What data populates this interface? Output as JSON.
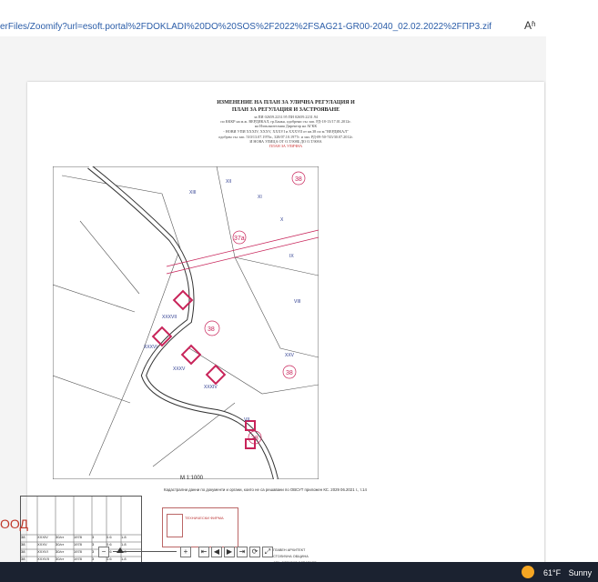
{
  "address_bar": {
    "url": "erFiles/Zoomify?url=esoft.portal%2FDOKLADI%20DO%20SOS%2F2022%2FSAG21-GR00-2040_02.02.2022%2FПР3.zif",
    "reader_label": "Aʱ"
  },
  "document": {
    "title_line1": "ИЗМЕНЕНИЕ НА ПЛАН ЗА УЛИЧНА РЕГУЛАЦИЯ И",
    "title_line2": "ПЛАН ЗА РЕГУЛАЦИЯ И ЗАСТРОЯВАНЕ",
    "subtitle_lines": [
      "за ПИ 02659.2231.95 ПИ 02659.2231.94",
      "по КККР на м.ж. ВЕРДИКАЛ, гр.Банкя, одобрени със зап. РД-18-13/17.01.2012г.",
      "на Изпълнителния Директор на АГКК",
      "- НОВИ УПИ XXXIV, XXXV, XXXVI и XXXVII от кв.38 по м.\"ВЕРДИКАЛ\"",
      "одобрен със зап. 510/13.07.1976г., 328/07.10.1977г. и зап. РД-09-50-745/30.07.2012г.",
      "И НОВА УЛИЦА ОТ О.Т.908Б ДО О.Т.908А",
      "ПЛАН ЗА УЛИЧНА"
    ],
    "scale_label": "М 1:1000",
    "note_text": "Кадастрални данни по документи и органи, които не са решавани по ОВСУТ приложен КС. 2029 06.2021 г., т.14",
    "stamp_text": "ТЕХНИЧЕСКИ ФИРМА",
    "signatures": [
      "ГЛАВЕН АРХИТЕКТ",
      "СТОЛИЧНА ОБЩИНА",
      "АРХ. ЗДРАВКО ЗДРАВКОВ"
    ],
    "table_rows": [
      [
        "38",
        "XXXIV",
        "30/ст",
        "1978",
        "3",
        "0.6",
        "1.8"
      ],
      [
        "38",
        "XXXV",
        "30/ст",
        "1978",
        "3",
        "0.6",
        "1.8"
      ],
      [
        "38",
        "XXXVI",
        "30/ст",
        "1978",
        "3",
        "0.6",
        "1.8"
      ],
      [
        "38",
        "XXXVII",
        "30/ст",
        "1978",
        "3",
        "0.6",
        "1.8"
      ]
    ],
    "map_labels": [
      "38",
      "37a",
      "38",
      "38",
      "38",
      "XXXVII",
      "XXXVI",
      "XXXV",
      "XXXIV",
      "XXV",
      "XIII",
      "XII",
      "XI",
      "X",
      "IX",
      "VIII",
      "VII"
    ]
  },
  "watermark": {
    "text": "ООД"
  },
  "toolbar": {
    "minus": "−",
    "plus": "+",
    "first": "⇤",
    "prev": "◀",
    "next": "▶",
    "last": "⇥",
    "rotate": "⟳",
    "fit": "⤢"
  },
  "taskbar": {
    "temperature": "61°F",
    "condition": "Sunny"
  },
  "colors": {
    "parcel_outline": "#c8245a",
    "street": "#3a3a3a",
    "green": "#3c8c3c"
  }
}
